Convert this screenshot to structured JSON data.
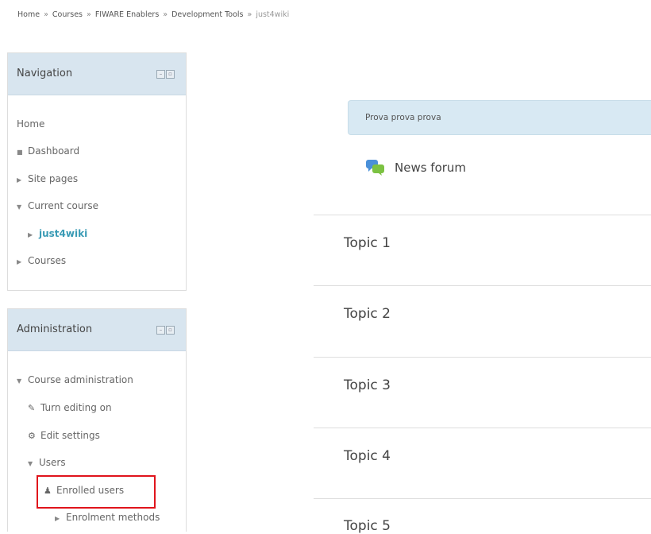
{
  "breadcrumb": {
    "items": [
      "Home",
      "Courses",
      "FIWARE Enablers",
      "Development Tools",
      "just4wiki"
    ],
    "separator": "»"
  },
  "navigation": {
    "title": "Navigation",
    "home": "Home",
    "dashboard": "Dashboard",
    "site_pages": "Site pages",
    "current_course": "Current course",
    "course_name": "just4wiki",
    "courses": "Courses"
  },
  "administration": {
    "title": "Administration",
    "course_admin": "Course administration",
    "turn_editing_on": "Turn editing on",
    "edit_settings": "Edit settings",
    "users": "Users",
    "enrolled_users": "Enrolled users",
    "enrolment_methods": "Enrolment methods"
  },
  "main": {
    "summary": "Prova prova prova",
    "news_forum": "News forum",
    "topics": [
      "Topic 1",
      "Topic 2",
      "Topic 3",
      "Topic 4",
      "Topic 5"
    ]
  },
  "colors": {
    "block_header_bg": "#d8e5ef",
    "summary_bg": "#d8e9f3",
    "active_link": "#3a9bb5",
    "highlight": "#e0141c"
  }
}
